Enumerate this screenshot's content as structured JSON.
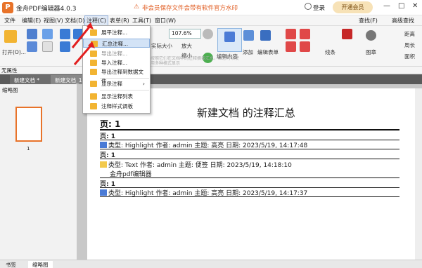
{
  "app": {
    "logo": "P",
    "title": "金舟PDF编辑器4.0.3",
    "notice": "非会员保存文件会带有软件官方水印",
    "login": "登录",
    "vip": "开通会员",
    "winctl": [
      "—",
      "□",
      "✕"
    ]
  },
  "menu": {
    "items": [
      "文件",
      "编辑(E)",
      "视图(V)",
      "文档(D)",
      "注释(C)",
      "表单(R)",
      "工具(T)",
      "窗口(W)"
    ],
    "right": [
      "查找(F)",
      "高级查找"
    ]
  },
  "toolbar": {
    "open": "打开(O)...",
    "zoom": "107.6%",
    "zoom_in": "放大",
    "zoom_out": "缩小",
    "actual": "实际大小",
    "edit_content": "编辑内容",
    "add": "添加",
    "edit_form": "编辑表单",
    "line": "线条",
    "stamp": "图章",
    "dist": "距离",
    "perimeter": "周长",
    "area": "面积"
  },
  "attrbar": "无属性",
  "tabs": {
    "doc1": "新建文档 *",
    "doc2": "新建文档_1"
  },
  "side": {
    "title": "缩略图",
    "page_num": "1",
    "bottom_tabs": [
      "书签",
      "缩略图"
    ]
  },
  "dropdown": {
    "items": [
      "展平注释...",
      "汇总注释...",
      "导出注释...",
      "导入注释...",
      "导出注释到数据文件...",
      "显示注释",
      "显示注释列表",
      "注释样式调板"
    ],
    "overlay_hint": "按照它们在文档中的注释摘要汇总，汇总可以使用多种格式显示"
  },
  "doc": {
    "title": "新建文档 的注释汇总",
    "page_header": "页: 1",
    "page_label": "页: 1",
    "annotations": [
      {
        "text": "类型: Highlight  作者: admin  主题: 高亮  日期: 2023/5/19, 14:17:48",
        "icon": "highlight-icon",
        "color": "#4a7bd6"
      },
      {
        "text": "类型: Text  作者: admin  主题: 便签  日期: 2023/5/19, 14:18:10",
        "icon": "note-icon",
        "color": "#f2c94c"
      },
      {
        "text": "类型: Highlight  作者: admin  主题: 高亮  日期: 2023/5/19, 14:17:37",
        "icon": "highlight-icon",
        "color": "#4a7bd6"
      }
    ],
    "note_content": "金舟pdf编辑器"
  }
}
